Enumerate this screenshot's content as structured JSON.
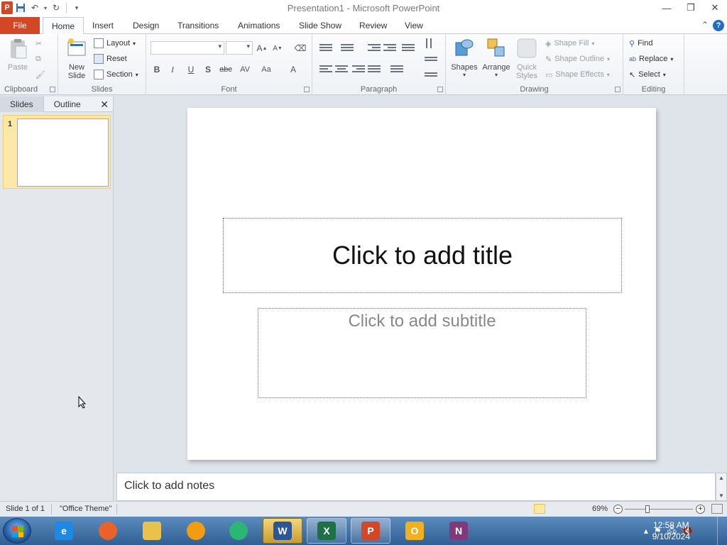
{
  "window": {
    "title": "Presentation1 - Microsoft PowerPoint",
    "app_icon_letter": "P"
  },
  "quick_access": [
    "save-icon",
    "undo-icon",
    "redo-icon",
    "customize-icon"
  ],
  "tabs": {
    "file": "File",
    "items": [
      "Home",
      "Insert",
      "Design",
      "Transitions",
      "Animations",
      "Slide Show",
      "Review",
      "View"
    ],
    "active": "Home"
  },
  "ribbon": {
    "clipboard": {
      "label": "Clipboard",
      "paste": "Paste"
    },
    "slides": {
      "label": "Slides",
      "new_slide": "New Slide",
      "new_slide_l1": "New",
      "new_slide_l2": "Slide",
      "layout": "Layout",
      "reset": "Reset",
      "section": "Section"
    },
    "font": {
      "label": "Font",
      "bold": "B",
      "italic": "I",
      "underline": "U",
      "strike": "S",
      "strike2": "abc",
      "spacing": "AV",
      "case": "Aa",
      "color": "A"
    },
    "paragraph": {
      "label": "Paragraph"
    },
    "drawing": {
      "label": "Drawing",
      "shapes": "Shapes",
      "arrange": "Arrange",
      "quick_styles_l1": "Quick",
      "quick_styles_l2": "Styles",
      "shape_fill": "Shape Fill",
      "shape_outline": "Shape Outline",
      "shape_effects": "Shape Effects"
    },
    "editing": {
      "label": "Editing",
      "find": "Find",
      "replace": "Replace",
      "select": "Select"
    }
  },
  "left_pane": {
    "tabs": [
      "Slides",
      "Outline"
    ],
    "active_tab": "Slides",
    "slides": [
      {
        "number": "1"
      }
    ]
  },
  "slide": {
    "title_placeholder": "Click to add title",
    "subtitle_placeholder": "Click to add subtitle"
  },
  "notes": {
    "placeholder": "Click to add notes"
  },
  "statusbar": {
    "slide_info": "Slide 1 of 1",
    "theme": "\"Office Theme\"",
    "zoom": "69%",
    "zoom_value": 0.69
  },
  "taskbar": {
    "apps": [
      {
        "name": "internet-explorer",
        "state": "pinned",
        "letter": "e",
        "color": "#1e88e5"
      },
      {
        "name": "firefox",
        "state": "pinned",
        "letter": "",
        "color": "#e8622a"
      },
      {
        "name": "file-explorer",
        "state": "pinned",
        "letter": "",
        "color": "#e9c24c"
      },
      {
        "name": "media-player",
        "state": "pinned",
        "letter": "",
        "color": "#f39c12"
      },
      {
        "name": "messenger",
        "state": "pinned",
        "letter": "",
        "color": "#2bb673"
      },
      {
        "name": "word",
        "state": "active",
        "letter": "W",
        "color": "#2b5797"
      },
      {
        "name": "excel",
        "state": "open",
        "letter": "X",
        "color": "#1e7145"
      },
      {
        "name": "powerpoint",
        "state": "open",
        "letter": "P",
        "color": "#d24726"
      },
      {
        "name": "outlook",
        "state": "pinned",
        "letter": "O",
        "color": "#f2b01e"
      },
      {
        "name": "onenote",
        "state": "pinned",
        "letter": "N",
        "color": "#80397b"
      }
    ],
    "time": "12:58 AM",
    "date": "9/10/2024"
  },
  "colors": {
    "file_tab": "#d24726",
    "selection": "#fce9a7",
    "taskbar": "#3a6ea5"
  }
}
